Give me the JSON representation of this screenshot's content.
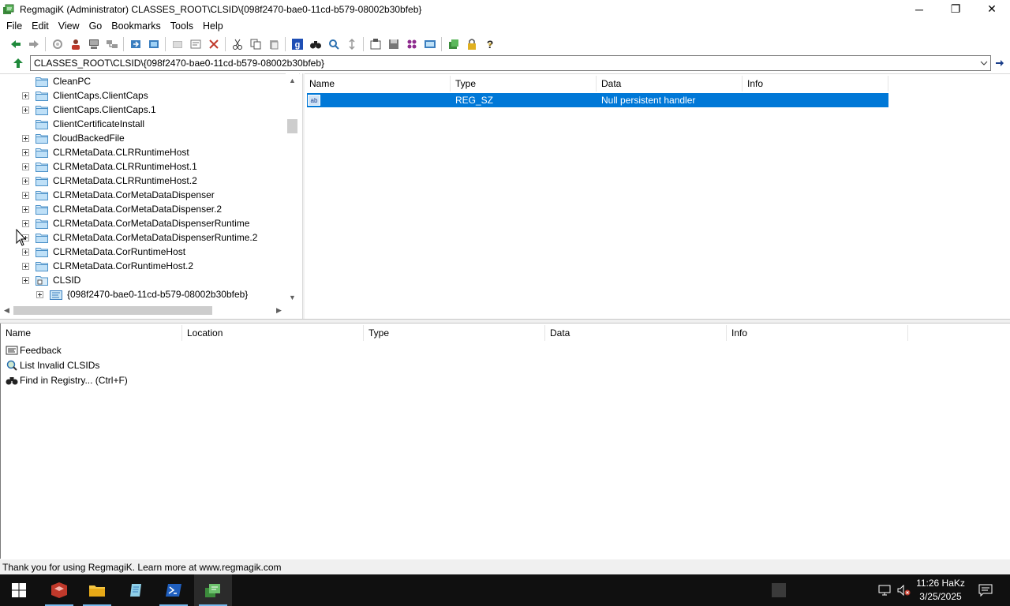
{
  "window": {
    "title": "RegmagiK (Administrator) CLASSES_ROOT\\CLSID\\{098f2470-bae0-11cd-b579-08002b30bfeb}",
    "minimize": "─",
    "restore": "❐",
    "close": "✕"
  },
  "menu": [
    "File",
    "Edit",
    "View",
    "Go",
    "Bookmarks",
    "Tools",
    "Help"
  ],
  "toolbar": {
    "icons": [
      "back-icon",
      "forward-icon",
      "refresh-icon",
      "user-icon",
      "computer-icon",
      "network-icon",
      "import-icon",
      "export-icon",
      "new-key-icon",
      "new-value-icon",
      "delete-icon",
      "cut-icon",
      "copy-icon",
      "paste-icon",
      "google-icon",
      "find-icon",
      "find-next-icon",
      "sort-icon",
      "properties-icon",
      "save-icon",
      "colors-icon",
      "compare-icon",
      "options-icon",
      "lock-icon",
      "help-icon"
    ]
  },
  "address": {
    "value": "CLASSES_ROOT\\CLSID\\{098f2470-bae0-11cd-b579-08002b30bfeb}"
  },
  "tree": {
    "items": [
      {
        "label": "CleanPC",
        "expandable": false
      },
      {
        "label": "ClientCaps.ClientCaps",
        "expandable": true
      },
      {
        "label": "ClientCaps.ClientCaps.1",
        "expandable": true
      },
      {
        "label": "ClientCertificateInstall",
        "expandable": false
      },
      {
        "label": "CloudBackedFile",
        "expandable": true
      },
      {
        "label": "CLRMetaData.CLRRuntimeHost",
        "expandable": true
      },
      {
        "label": "CLRMetaData.CLRRuntimeHost.1",
        "expandable": true
      },
      {
        "label": "CLRMetaData.CLRRuntimeHost.2",
        "expandable": true
      },
      {
        "label": "CLRMetaData.CorMetaDataDispenser",
        "expandable": true
      },
      {
        "label": "CLRMetaData.CorMetaDataDispenser.2",
        "expandable": true
      },
      {
        "label": "CLRMetaData.CorMetaDataDispenserRuntime",
        "expandable": true
      },
      {
        "label": "CLRMetaData.CorMetaDataDispenserRuntime.2",
        "expandable": true
      },
      {
        "label": "CLRMetaData.CorRuntimeHost",
        "expandable": true
      },
      {
        "label": "CLRMetaData.CorRuntimeHost.2",
        "expandable": true
      },
      {
        "label": "CLSID",
        "expandable": true
      },
      {
        "label": "{098f2470-bae0-11cd-b579-08002b30bfeb}",
        "expandable": true
      }
    ]
  },
  "values": {
    "columns": [
      "Name",
      "Type",
      "Data",
      "Info"
    ],
    "rows": [
      {
        "name": "",
        "type": "REG_SZ",
        "data": "Null persistent handler",
        "info": ""
      }
    ]
  },
  "bottom": {
    "columns": [
      "Name",
      "Location",
      "Type",
      "Data",
      "Info"
    ],
    "items": [
      {
        "label": "Feedback"
      },
      {
        "label": "List Invalid CLSIDs"
      },
      {
        "label": "Find in Registry...  (Ctrl+F)"
      }
    ]
  },
  "status": "Thank you for using RegmagiK. Learn more at www.regmagik.com",
  "taskbar": {
    "clock_time": "11:26 HaKz",
    "clock_date": "3/25/2025"
  }
}
